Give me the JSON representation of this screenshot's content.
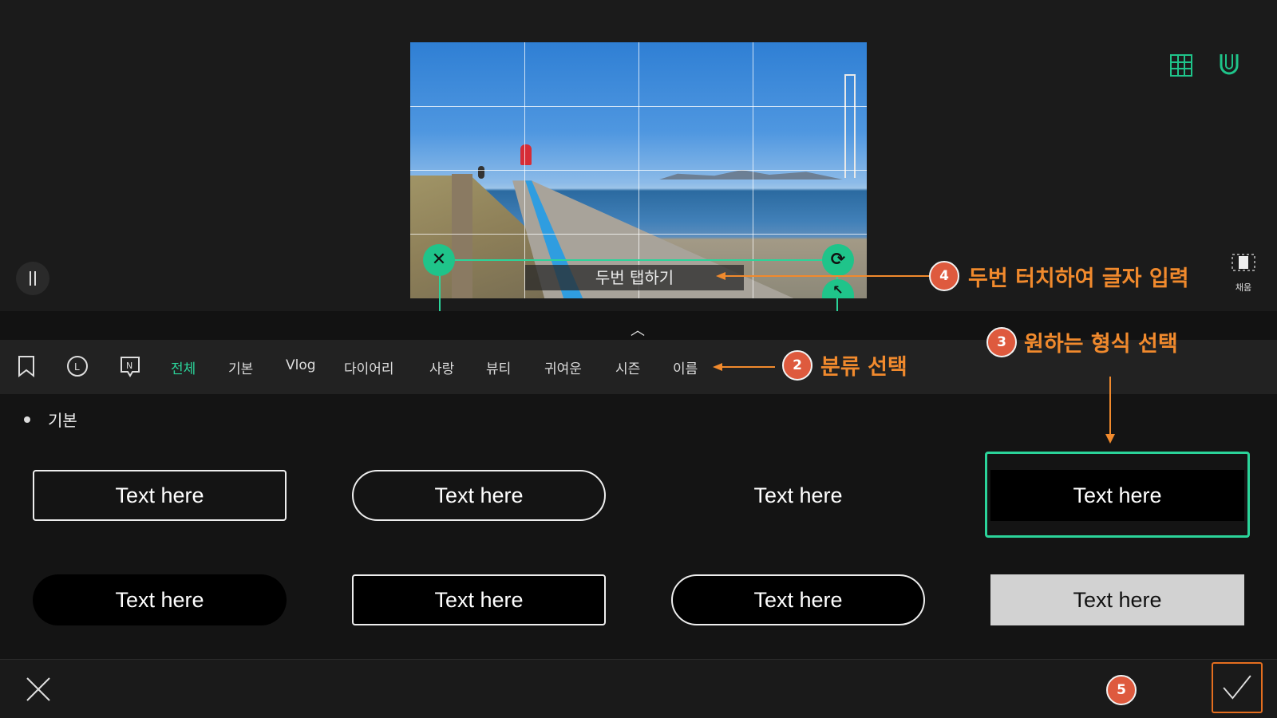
{
  "preview": {
    "caption_text": "두번 탭하기",
    "fill_label": "채움"
  },
  "categories": {
    "tabs": [
      {
        "label": "전체",
        "active": true
      },
      {
        "label": "기본",
        "active": false
      },
      {
        "label": "Vlog",
        "active": false
      },
      {
        "label": "다이어리",
        "active": false
      },
      {
        "label": "사랑",
        "active": false
      },
      {
        "label": "뷰티",
        "active": false
      },
      {
        "label": "귀여운",
        "active": false
      },
      {
        "label": "시즌",
        "active": false
      },
      {
        "label": "이름",
        "active": false
      }
    ]
  },
  "section": {
    "title": "기본",
    "styles": [
      {
        "label": "Text here",
        "variant": "outline-rect"
      },
      {
        "label": "Text here",
        "variant": "outline-pill"
      },
      {
        "label": "Text here",
        "variant": "plain"
      },
      {
        "label": "Text here",
        "variant": "black-rect",
        "selected": true
      },
      {
        "label": "Text here",
        "variant": "black-pill"
      },
      {
        "label": "Text here",
        "variant": "black-rect-outline"
      },
      {
        "label": "Text here",
        "variant": "black-pill-outline"
      },
      {
        "label": "Text here",
        "variant": "gray-rect"
      }
    ]
  },
  "annotations": [
    {
      "number": "4",
      "text": "두번 터치하여 글자 입력"
    },
    {
      "number": "3",
      "text": "원하는 형식 선택"
    },
    {
      "number": "2",
      "text": "분류 선택"
    },
    {
      "number": "5",
      "text": ""
    }
  ],
  "colors": {
    "accent": "#2bd49a",
    "annotation": "#f18a2d",
    "badge": "#de5a3e",
    "background": "#1a1a1a"
  },
  "icons": [
    "pause-icon",
    "grid-icon",
    "magnet-icon",
    "fill-icon",
    "chevron-up-icon",
    "bookmark-icon",
    "recent-icon",
    "new-icon",
    "close-icon",
    "check-icon",
    "rotate-icon",
    "resize-icon"
  ]
}
